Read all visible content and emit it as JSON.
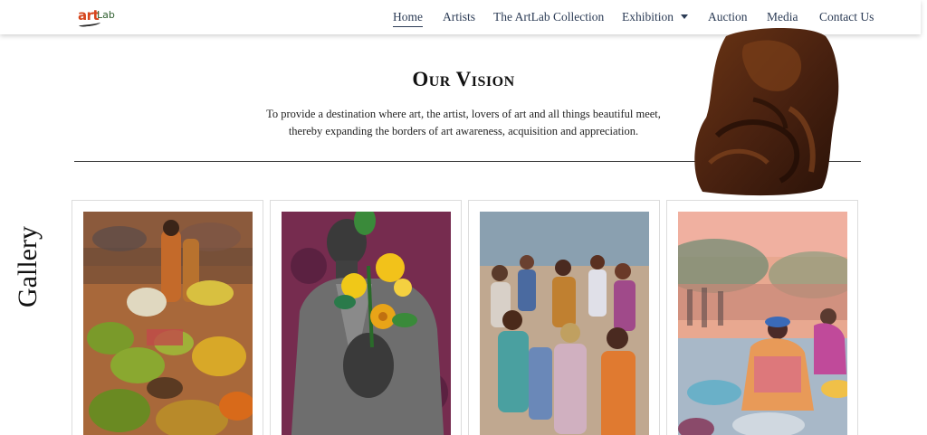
{
  "header": {
    "logo": {
      "part1": "art",
      "part2": "Lab"
    },
    "nav": [
      {
        "label": "Home",
        "active": true
      },
      {
        "label": "Artists"
      },
      {
        "label": "The ArtLab Collection"
      },
      {
        "label": "Exhibition",
        "has_dropdown": true
      },
      {
        "label": "Auction"
      },
      {
        "label": "Media"
      },
      {
        "label": "Contact Us"
      }
    ]
  },
  "vision": {
    "title": "Our Vision",
    "line1": "To provide a destination where art, the artist, lovers of art and all things beautiful meet,",
    "line2": "thereby expanding the borders of art awareness, acquisition and appreciation."
  },
  "gallery": {
    "label": "Gallery",
    "items": [
      {
        "subject": "market-fruit-painting"
      },
      {
        "subject": "man-with-flowers-painting"
      },
      {
        "subject": "market-crowd-painting"
      },
      {
        "subject": "women-washing-painting"
      }
    ]
  },
  "colors": {
    "nav_text": "#2b3b55",
    "logo_orange": "#d6451c",
    "logo_green": "#2f5f2f"
  }
}
